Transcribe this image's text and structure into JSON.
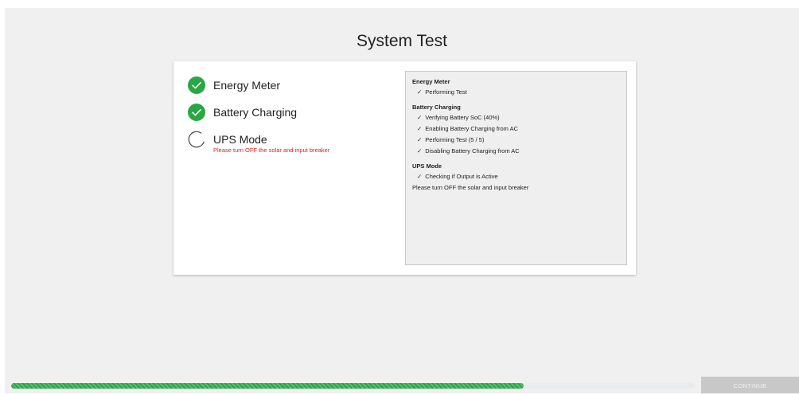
{
  "page_title": "System Test",
  "colors": {
    "success": "#28a745",
    "error_text": "#e01e1e",
    "panel_bg": "#efefef"
  },
  "steps": [
    {
      "label": "Energy Meter",
      "status": "complete",
      "icon": "check-circle-icon",
      "message": ""
    },
    {
      "label": "Battery Charging",
      "status": "complete",
      "icon": "check-circle-icon",
      "message": ""
    },
    {
      "label": "UPS Mode",
      "status": "in-progress",
      "icon": "spinner-icon",
      "message": "Please turn OFF the solar and input breaker"
    }
  ],
  "log": {
    "groups": [
      {
        "heading": "Energy Meter",
        "items": [
          "Performing Test"
        ]
      },
      {
        "heading": "Battery Charging",
        "items": [
          "Verifying Battery SoC (40%)",
          "Enabling Battery Charging from AC",
          "Performing Test (5 / 5)",
          "Disabling Battery Charging from AC"
        ]
      },
      {
        "heading": "UPS Mode",
        "items": [
          "Checking if Output is Active"
        ],
        "note": "Please turn OFF the solar and input breaker"
      }
    ]
  },
  "progress": {
    "fraction": 0.75
  },
  "continue_label": "CONTINUE"
}
